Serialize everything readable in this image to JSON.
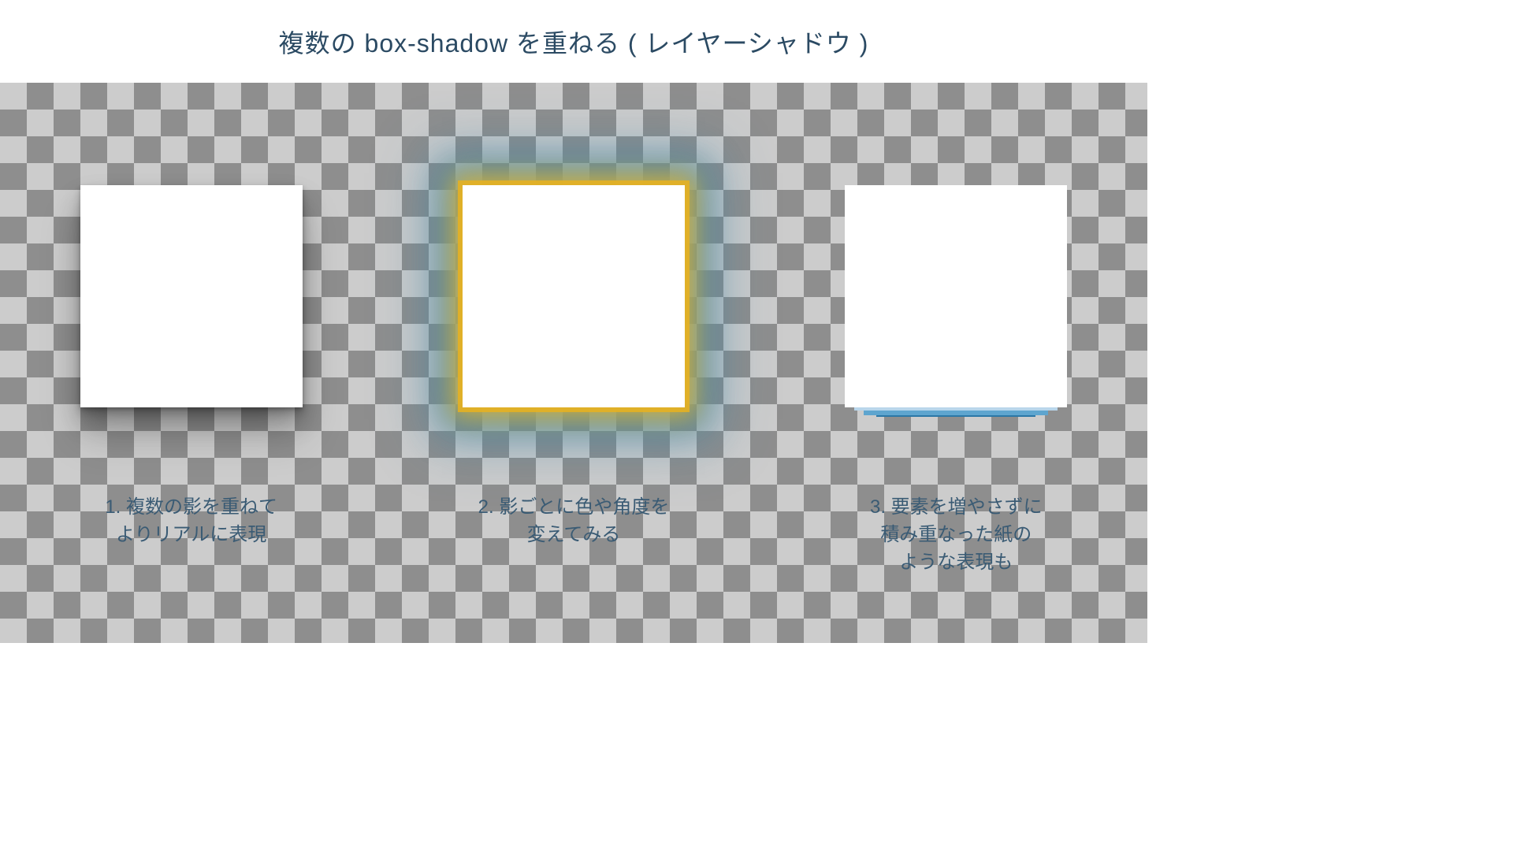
{
  "title": "複数の box-shadow を重ねる ( レイヤーシャドウ )",
  "examples": [
    {
      "caption": "1. 複数の影を重ねて\nよりリアルに表現"
    },
    {
      "caption": "2. 影ごとに色や角度を\n変えてみる"
    },
    {
      "caption": "3. 要素を増やさずに\n積み重なった紙の\nような表現も"
    }
  ]
}
